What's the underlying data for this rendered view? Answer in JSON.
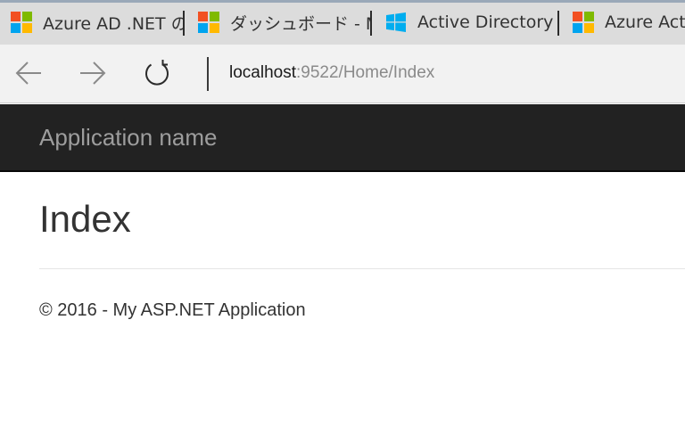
{
  "tabs": [
    {
      "title": "Azure AD .NET の",
      "icon": "microsoft-logo"
    },
    {
      "title": "ダッシュボード - Mic",
      "icon": "microsoft-logo"
    },
    {
      "title": "Active Directory -",
      "icon": "windows-logo"
    },
    {
      "title": "Azure Acti",
      "icon": "microsoft-logo"
    }
  ],
  "address_bar": {
    "host": "localhost",
    "path": ":9522/Home/Index"
  },
  "nav_icons": [
    "back-arrow-icon",
    "forward-arrow-icon",
    "refresh-icon"
  ],
  "page": {
    "brand": "Application name",
    "title": "Index",
    "footer": "© 2016 - My ASP.NET Application"
  },
  "colors": {
    "ms_red": "#f25022",
    "ms_green": "#7fba00",
    "ms_blue": "#00a4ef",
    "ms_yellow": "#ffb900",
    "windows_blue": "#00adef",
    "navbar_bg": "#222222",
    "brand_text": "#9d9d9d"
  }
}
